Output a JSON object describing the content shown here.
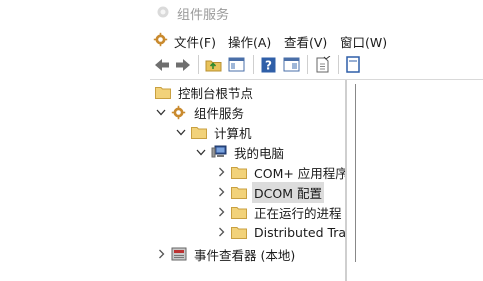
{
  "window": {
    "title": "组件服务"
  },
  "menu": [
    "文件(F)",
    "操作(A)",
    "查看(V)",
    "窗口(W)"
  ],
  "toolbar": {
    "buttons": [
      "back-arrow-icon",
      "forward-arrow-icon",
      "up-folder-icon",
      "show-hide-tree-icon",
      "help-icon",
      "properties-icon",
      "export-list-icon",
      "show-console-tree-icon"
    ]
  },
  "tree": {
    "root": "控制台根节点",
    "component_services": "组件服务",
    "computers": "计算机",
    "my_computer": "我的电脑",
    "com_apps": "COM+ 应用程序",
    "dcom_config": "DCOM 配置",
    "running_processes": "正在运行的进程",
    "distributed": "Distributed Trar",
    "event_viewer": "事件查看器 (本地)"
  }
}
